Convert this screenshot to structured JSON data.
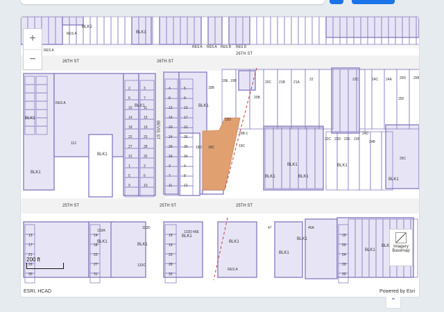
{
  "map": {
    "zoom_in": "+",
    "zoom_out": "−",
    "scale_label": "200 ft",
    "attribution": "ESRI, HCAD",
    "powered_by": "Powered by Esri",
    "basemap_label_1": "Imagery",
    "basemap_label_2": "Basemap",
    "expand_icon": "⌃",
    "colors": {
      "parcel_fill": "#e7e5f5",
      "parcel_line": "#8a7fc2",
      "street": "#f2f2f2",
      "highlight": "#e0a070",
      "rail": "#c04040"
    },
    "streets": [
      "26TH ST",
      "26TH ST",
      "26TH ST",
      "25TH ST",
      "25TH ST",
      "25TH ST",
      "BEVIS ST"
    ],
    "block_labels": [
      "BLK1",
      "BLK1",
      "BLK1",
      "BLK1",
      "BLK1",
      "BLK1",
      "BLK1",
      "BLK1",
      "BLK1",
      "BLK1",
      "BLK1",
      "BLK1",
      "BLK1",
      "BLK1",
      "BLK1",
      "BLK1",
      "BLK1",
      "BLK1",
      "BLK1",
      "BLK1"
    ],
    "reserve_labels": [
      "RES A",
      "RES A",
      "RES A",
      "RES A",
      "RES B",
      "RES D",
      "RES A",
      "RES A"
    ],
    "lot_labels": [
      "18B",
      "19E",
      "19B",
      "20C",
      "21B",
      "21A",
      "22",
      "23C",
      "24C",
      "24A",
      "25D",
      "25B",
      "20B",
      "25F",
      "18D",
      "18C",
      "19D",
      "20B-1",
      "19C",
      "22C",
      "23D",
      "23E",
      "23F",
      "24D",
      "24B",
      "25C",
      "133A",
      "133D",
      "49E",
      "47",
      "45A",
      "113D",
      "133C",
      "112",
      "1",
      "2",
      "3",
      "4",
      "5",
      "6",
      "7",
      "8",
      "9",
      "10",
      "11",
      "12",
      "13",
      "14",
      "15",
      "16",
      "17",
      "18",
      "19",
      "20",
      "21",
      "22",
      "23",
      "24",
      "26",
      "27",
      "28",
      "29",
      "30",
      "31",
      "32",
      "33",
      "34"
    ]
  }
}
